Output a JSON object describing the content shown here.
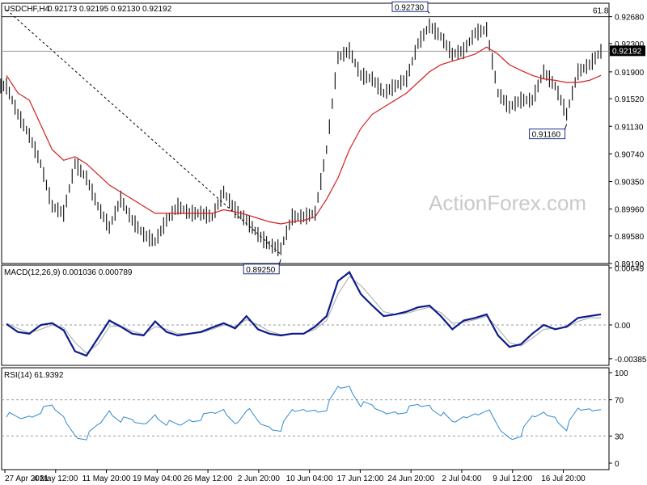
{
  "chart_data": [
    {
      "type": "candlestick",
      "header": {
        "symbol": "USDCHF,H4",
        "ohlc": [
          "0.92173",
          "0.92195",
          "0.92130",
          "0.92192"
        ]
      },
      "ylim": [
        0.8919,
        0.9287
      ],
      "y_ticks": [
        "0.92680",
        "0.92300",
        "0.91900",
        "0.91520",
        "0.91130",
        "0.90740",
        "0.90350",
        "0.89960",
        "0.89580",
        "0.89190"
      ],
      "current_price": "0.92192",
      "level_line": {
        "label": "61.8",
        "value": 0.9268
      },
      "annotations": [
        {
          "text": "0.89250",
          "value": 0.8925,
          "date": "9 Jun"
        },
        {
          "text": "0.92730",
          "value": 0.9273,
          "date": "29 Jun"
        },
        {
          "text": "0.91160",
          "value": 0.9116,
          "date": "15 Jul"
        }
      ],
      "ma_color": "#d41f1f",
      "price_color": "#1a1a1a",
      "watermark": "ActionForex.com",
      "series_close_points": [
        {
          "date": "27 Apr",
          "close": 0.917
        },
        {
          "date": "29 Apr",
          "close": 0.913
        },
        {
          "date": "4 May",
          "close": 0.91
        },
        {
          "date": "6 May",
          "close": 0.906
        },
        {
          "date": "7 May",
          "close": 0.9
        },
        {
          "date": "10 May",
          "close": 0.899
        },
        {
          "date": "11 May",
          "close": 0.906
        },
        {
          "date": "13 May",
          "close": 0.904
        },
        {
          "date": "14 May",
          "close": 0.9
        },
        {
          "date": "17 May",
          "close": 0.897
        },
        {
          "date": "19 May",
          "close": 0.901
        },
        {
          "date": "20 May",
          "close": 0.898
        },
        {
          "date": "21 May",
          "close": 0.896
        },
        {
          "date": "24 May",
          "close": 0.895
        },
        {
          "date": "26 May",
          "close": 0.898
        },
        {
          "date": "27 May",
          "close": 0.9
        },
        {
          "date": "28 May",
          "close": 0.899
        },
        {
          "date": "31 May",
          "close": 0.899
        },
        {
          "date": "1 Jun",
          "close": 0.8985
        },
        {
          "date": "2 Jun",
          "close": 0.902
        },
        {
          "date": "3 Jun",
          "close": 0.8995
        },
        {
          "date": "4 Jun",
          "close": 0.898
        },
        {
          "date": "7 Jun",
          "close": 0.896
        },
        {
          "date": "8 Jun",
          "close": 0.8945
        },
        {
          "date": "9 Jun",
          "close": 0.894
        },
        {
          "date": "10 Jun",
          "close": 0.8985
        },
        {
          "date": "11 Jun",
          "close": 0.8985
        },
        {
          "date": "14 Jun",
          "close": 0.899
        },
        {
          "date": "16 Jun",
          "close": 0.908
        },
        {
          "date": "17 Jun",
          "close": 0.921
        },
        {
          "date": "18 Jun",
          "close": 0.922
        },
        {
          "date": "21 Jun",
          "close": 0.9185
        },
        {
          "date": "22 Jun",
          "close": 0.918
        },
        {
          "date": "23 Jun",
          "close": 0.916
        },
        {
          "date": "24 Jun",
          "close": 0.917
        },
        {
          "date": "25 Jun",
          "close": 0.918
        },
        {
          "date": "28 Jun",
          "close": 0.923
        },
        {
          "date": "29 Jun",
          "close": 0.9255
        },
        {
          "date": "30 Jun",
          "close": 0.924
        },
        {
          "date": "1 Jul",
          "close": 0.9215
        },
        {
          "date": "2 Jul",
          "close": 0.922
        },
        {
          "date": "5 Jul",
          "close": 0.9245
        },
        {
          "date": "6 Jul",
          "close": 0.925
        },
        {
          "date": "7 Jul",
          "close": 0.916
        },
        {
          "date": "8 Jul",
          "close": 0.914
        },
        {
          "date": "9 Jul",
          "close": 0.915
        },
        {
          "date": "12 Jul",
          "close": 0.915
        },
        {
          "date": "13 Jul",
          "close": 0.919
        },
        {
          "date": "14 Jul",
          "close": 0.917
        },
        {
          "date": "15 Jul",
          "close": 0.913
        },
        {
          "date": "16 Jul",
          "close": 0.919
        },
        {
          "date": "19 Jul",
          "close": 0.92
        },
        {
          "date": "20 Jul",
          "close": 0.9219
        }
      ],
      "ma_points": [
        {
          "date": "27 Apr",
          "value": 0.9185
        },
        {
          "date": "29 Apr",
          "value": 0.916
        },
        {
          "date": "4 May",
          "value": 0.915
        },
        {
          "date": "6 May",
          "value": 0.9115
        },
        {
          "date": "7 May",
          "value": 0.908
        },
        {
          "date": "10 May",
          "value": 0.9065
        },
        {
          "date": "11 May",
          "value": 0.907
        },
        {
          "date": "13 May",
          "value": 0.906
        },
        {
          "date": "14 May",
          "value": 0.9045
        },
        {
          "date": "17 May",
          "value": 0.903
        },
        {
          "date": "19 May",
          "value": 0.902
        },
        {
          "date": "20 May",
          "value": 0.901
        },
        {
          "date": "21 May",
          "value": 0.9
        },
        {
          "date": "24 May",
          "value": 0.899
        },
        {
          "date": "26 May",
          "value": 0.899
        },
        {
          "date": "27 May",
          "value": 0.899
        },
        {
          "date": "28 May",
          "value": 0.899
        },
        {
          "date": "31 May",
          "value": 0.899
        },
        {
          "date": "1 Jun",
          "value": 0.899
        },
        {
          "date": "2 Jun",
          "value": 0.8995
        },
        {
          "date": "3 Jun",
          "value": 0.8992
        },
        {
          "date": "4 Jun",
          "value": 0.8988
        },
        {
          "date": "7 Jun",
          "value": 0.8983
        },
        {
          "date": "8 Jun",
          "value": 0.8978
        },
        {
          "date": "9 Jun",
          "value": 0.8975
        },
        {
          "date": "10 Jun",
          "value": 0.8978
        },
        {
          "date": "11 Jun",
          "value": 0.898
        },
        {
          "date": "14 Jun",
          "value": 0.8985
        },
        {
          "date": "16 Jun",
          "value": 0.901
        },
        {
          "date": "17 Jun",
          "value": 0.904
        },
        {
          "date": "18 Jun",
          "value": 0.908
        },
        {
          "date": "21 Jun",
          "value": 0.911
        },
        {
          "date": "22 Jun",
          "value": 0.913
        },
        {
          "date": "23 Jun",
          "value": 0.914
        },
        {
          "date": "24 Jun",
          "value": 0.915
        },
        {
          "date": "25 Jun",
          "value": 0.916
        },
        {
          "date": "28 Jun",
          "value": 0.9175
        },
        {
          "date": "29 Jun",
          "value": 0.919
        },
        {
          "date": "30 Jun",
          "value": 0.92
        },
        {
          "date": "1 Jul",
          "value": 0.9205
        },
        {
          "date": "2 Jul",
          "value": 0.921
        },
        {
          "date": "5 Jul",
          "value": 0.9215
        },
        {
          "date": "6 Jul",
          "value": 0.9225
        },
        {
          "date": "7 Jul",
          "value": 0.9215
        },
        {
          "date": "8 Jul",
          "value": 0.92
        },
        {
          "date": "9 Jul",
          "value": 0.9192
        },
        {
          "date": "12 Jul",
          "value": 0.9185
        },
        {
          "date": "13 Jul",
          "value": 0.918
        },
        {
          "date": "14 Jul",
          "value": 0.9178
        },
        {
          "date": "15 Jul",
          "value": 0.9175
        },
        {
          "date": "16 Jul",
          "value": 0.9175
        },
        {
          "date": "19 Jul",
          "value": 0.9178
        },
        {
          "date": "20 Jul",
          "value": 0.9185
        }
      ]
    },
    {
      "type": "line",
      "header": "MACD(12,26,9) 0.001036 0.000789",
      "ylim": [
        -0.0046,
        0.0068
      ],
      "y_ticks": [
        "0.00649",
        "0.00",
        "-0.003855"
      ],
      "zero_label": "0.00",
      "zero_value": 0.0,
      "colors": {
        "macd": "#0b1b8c",
        "signal": "#a8a8a8"
      },
      "macd": [
        0.0001,
        -0.0008,
        -0.001,
        0.0,
        0.0002,
        -0.0006,
        -0.003,
        -0.0035,
        -0.0015,
        0.0005,
        -0.0002,
        -0.001,
        -0.0012,
        0.0004,
        -0.0008,
        -0.0012,
        -0.001,
        -0.0008,
        -0.0003,
        0.0002,
        -0.0004,
        0.001,
        -0.0005,
        -0.001,
        -0.0012,
        -0.001,
        -0.001,
        -0.0002,
        0.001,
        0.005,
        0.006,
        0.0035,
        0.0022,
        0.001,
        0.0012,
        0.0015,
        0.002,
        0.0022,
        0.001,
        -0.0005,
        0.0005,
        0.0008,
        0.0012,
        -0.0012,
        -0.0025,
        -0.0022,
        -0.001,
        0.0,
        -0.0005,
        -0.0002,
        0.0008,
        0.001,
        0.0012
      ],
      "signal": [
        0.0002,
        -0.0004,
        -0.0009,
        -0.0005,
        0.0,
        -0.0003,
        -0.002,
        -0.0032,
        -0.0022,
        -0.0002,
        -0.0001,
        -0.0007,
        -0.0011,
        -0.0002,
        -0.0005,
        -0.001,
        -0.001,
        -0.0009,
        -0.0005,
        0.0,
        -0.0002,
        0.0006,
        0.0,
        -0.0007,
        -0.0011,
        -0.001,
        -0.001,
        -0.0005,
        0.0005,
        0.0035,
        0.0055,
        0.0045,
        0.003,
        0.0015,
        0.0012,
        0.0013,
        0.0017,
        0.002,
        0.0014,
        0.0002,
        0.0003,
        0.0006,
        0.001,
        -0.0004,
        -0.002,
        -0.0024,
        -0.0015,
        -0.0005,
        -0.0004,
        -0.0003,
        0.0004,
        0.0008,
        0.0008
      ]
    },
    {
      "type": "line",
      "header": "RSI(14) 61.9392",
      "ylim": [
        0,
        100
      ],
      "y_ticks": [
        "100",
        "70",
        "30",
        "0"
      ],
      "levels": [
        70,
        30
      ],
      "color": "#2e8ad0",
      "values": [
        55,
        48,
        52,
        58,
        60,
        50,
        32,
        30,
        40,
        58,
        48,
        44,
        42,
        55,
        46,
        40,
        48,
        50,
        52,
        58,
        45,
        62,
        44,
        40,
        38,
        55,
        58,
        60,
        62,
        82,
        85,
        65,
        60,
        55,
        58,
        60,
        62,
        64,
        55,
        42,
        50,
        56,
        62,
        38,
        28,
        32,
        48,
        55,
        52,
        40,
        58,
        60,
        62
      ]
    }
  ],
  "x_axis": {
    "ticks": [
      "27 Apr 2021",
      "4 May 12:00",
      "11 May 20:00",
      "19 May 04:00",
      "26 May 12:00",
      "2 Jun 20:00",
      "10 Jun 04:00",
      "17 Jun 12:00",
      "24 Jun 20:00",
      "2 Jul 04:00",
      "9 Jul 12:00",
      "16 Jul 20:00"
    ]
  }
}
